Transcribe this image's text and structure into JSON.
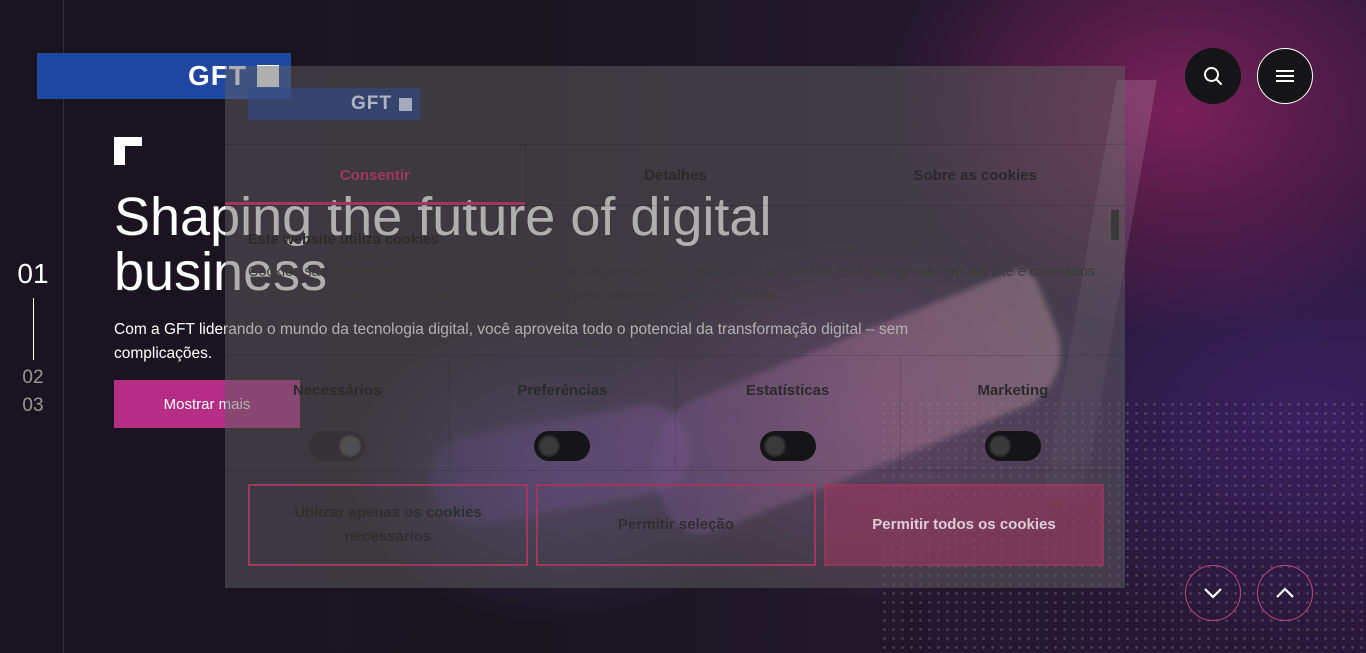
{
  "brand": {
    "logo_text": "GFT"
  },
  "header": {
    "search_icon": "search-icon",
    "menu_icon": "hamburger-menu-icon"
  },
  "slides": {
    "current": "01",
    "others": [
      "02",
      "03"
    ]
  },
  "hero": {
    "title": "Shaping the future of digital business",
    "subtitle": "Com a GFT liderando o mundo da tecnologia digital, você aproveita todo o potencial da transformação digital – sem complicações.",
    "cta_label": "Mostrar mais"
  },
  "cookie_banner": {
    "logo_text": "GFT",
    "tabs": [
      {
        "label": "Consentir",
        "active": true
      },
      {
        "label": "Detalhes",
        "active": false
      },
      {
        "label": "Sobre as cookies",
        "active": false
      }
    ],
    "heading": "Este website utiliza cookies",
    "body": "Cookies são pequenos blocos de dados criados por um servidor web enquanto um usuário está navegando em um site e colocados no computador do usuário ou em outro dispositivo pelo navegador web do usuário.",
    "categories": [
      {
        "label": "Necessários",
        "enabled": true,
        "locked": true
      },
      {
        "label": "Preferências",
        "enabled": false
      },
      {
        "label": "Estatísticas",
        "enabled": false
      },
      {
        "label": "Marketing",
        "enabled": false
      }
    ],
    "buttons": {
      "necessary_only": "Utilizar apenas os cookies necessários",
      "allow_selection": "Permitir seleção",
      "allow_all": "Permitir todos os cookies"
    },
    "accent_color": "#a2365f"
  },
  "scroll_nav": {
    "down_icon": "chevron-down-icon",
    "up_icon": "chevron-up-icon"
  },
  "colors": {
    "brand_blue": "#1f46a0",
    "cta_magenta": "#b52d84"
  }
}
